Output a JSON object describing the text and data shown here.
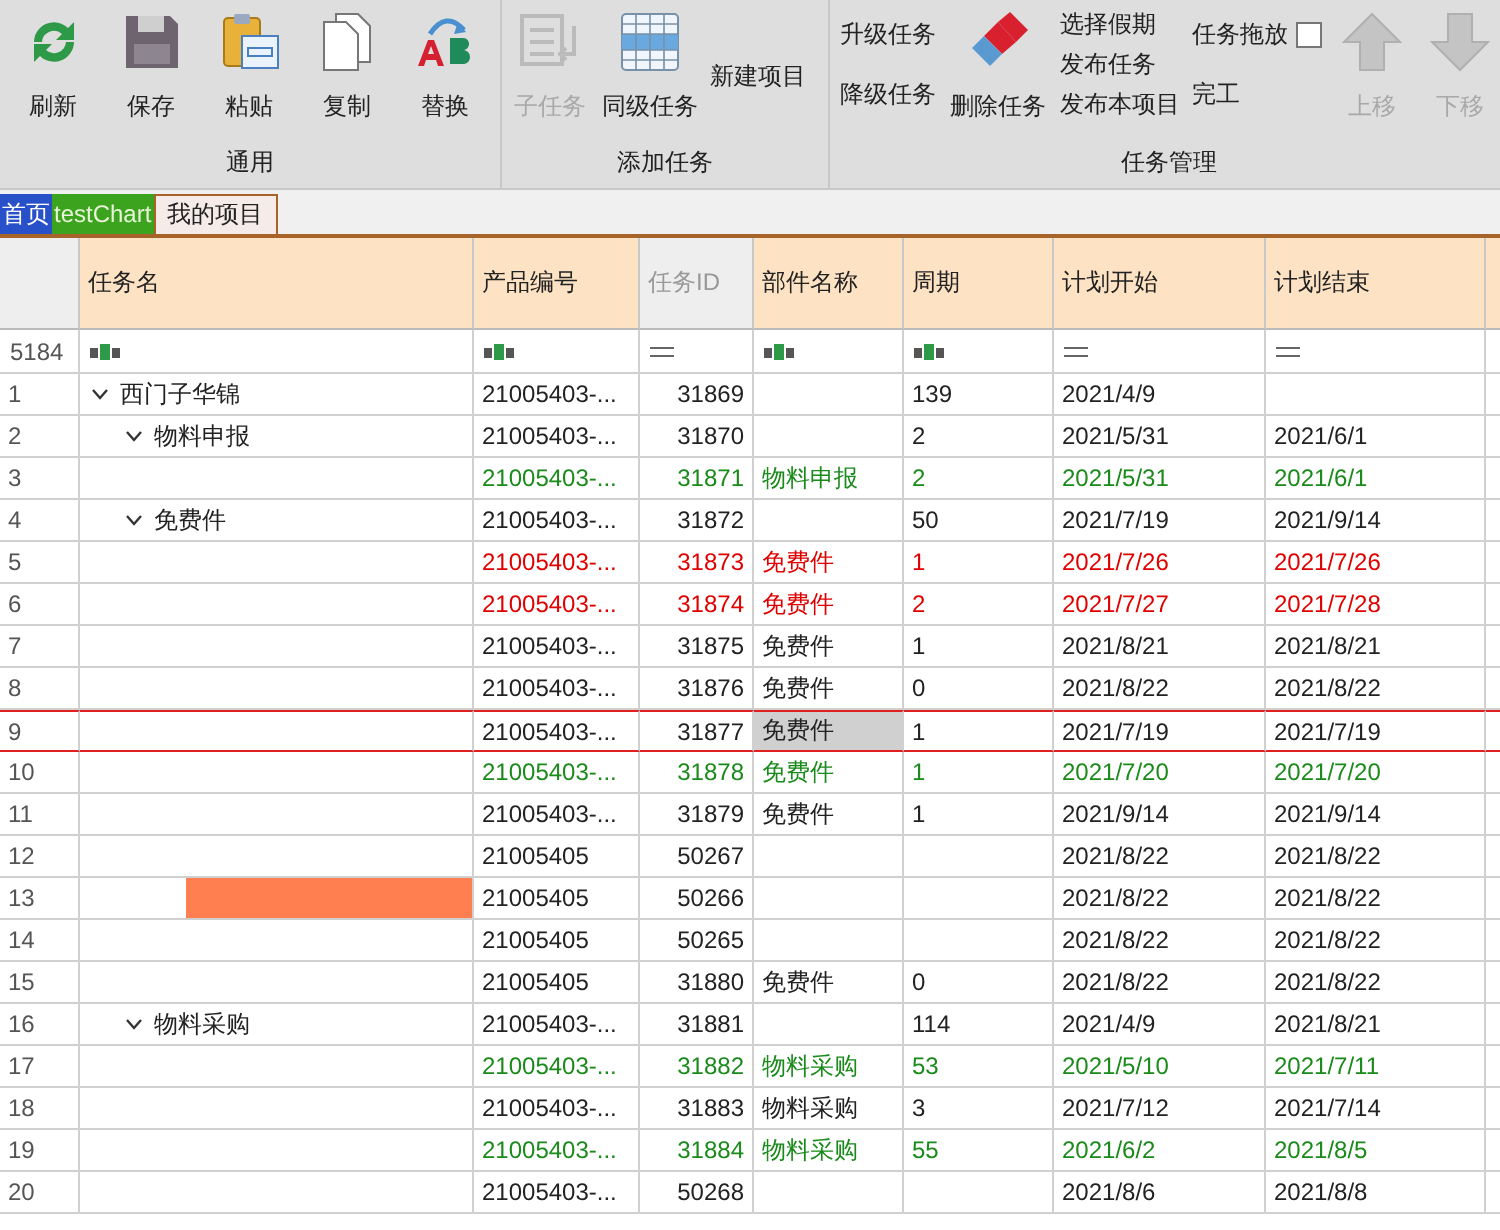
{
  "toolbar": {
    "groups": [
      {
        "label": "通用",
        "items": [
          {
            "kind": "large",
            "label": "刷新",
            "disabled": false
          },
          {
            "kind": "large",
            "label": "保存",
            "disabled": false
          },
          {
            "kind": "large",
            "label": "粘贴",
            "disabled": false
          },
          {
            "kind": "large",
            "label": "复制",
            "disabled": false
          },
          {
            "kind": "large",
            "label": "替换",
            "disabled": false
          }
        ]
      },
      {
        "label": "添加任务",
        "items": [
          {
            "kind": "large",
            "label": "子任务",
            "disabled": true
          },
          {
            "kind": "large",
            "label": "同级任务",
            "disabled": false
          },
          {
            "kind": "text",
            "label": "新建项目",
            "disabled": false
          }
        ]
      },
      {
        "label": "任务管理",
        "items": [
          {
            "kind": "stack",
            "entries": [
              {
                "label": "升级任务"
              },
              {
                "label": "降级任务"
              }
            ]
          },
          {
            "kind": "large",
            "label": "删除任务",
            "disabled": false
          },
          {
            "kind": "stack",
            "entries": [
              {
                "label": "选择假期"
              },
              {
                "label": "发布任务"
              },
              {
                "label": "发布本项目"
              }
            ]
          },
          {
            "kind": "checkstack",
            "check": {
              "label": "任务拖放",
              "checked": false
            },
            "label": "完工"
          },
          {
            "kind": "large",
            "label": "上移",
            "disabled": true
          },
          {
            "kind": "large",
            "label": "下移",
            "disabled": true
          }
        ]
      }
    ]
  },
  "tabs": [
    {
      "label": "首页",
      "color": "#2850c8",
      "selected": false
    },
    {
      "label": "testChart",
      "color": "#3ca31e",
      "selected": false
    },
    {
      "label": "我的项目",
      "color": "#f5ebe8",
      "selected": true
    }
  ],
  "grid": {
    "columns": [
      {
        "label": "任务名",
        "readonly": false,
        "kind": "text"
      },
      {
        "label": "产品编号",
        "readonly": false,
        "kind": "text"
      },
      {
        "label": "任务ID",
        "readonly": true,
        "kind": "equals"
      },
      {
        "label": "部件名称",
        "readonly": false,
        "kind": "text"
      },
      {
        "label": "周期",
        "readonly": false,
        "kind": "text"
      },
      {
        "label": "计划开始",
        "readonly": false,
        "kind": "equals"
      },
      {
        "label": "计划结束",
        "readonly": false,
        "kind": "equals"
      }
    ],
    "filter_count": "5184",
    "rows": [
      {
        "num": "1",
        "name": "西门子华锦",
        "expanded": true,
        "product": "21005403-...",
        "id": "31869",
        "period": "139",
        "start": "2021/4/9",
        "color": "#222222",
        "selected": false,
        "bar": false,
        "children": [
          {
            "num": "2",
            "name": "物料申报",
            "expanded": true,
            "product": "21005403-...",
            "id": "31870",
            "period": "2",
            "start": "2021/5/31",
            "end": "2021/6/1",
            "color": "#222222",
            "selected": false,
            "bar": false,
            "children": [
              {
                "num": "3",
                "product": "21005403-...",
                "id": "31871",
                "part": "物料申报",
                "period": "2",
                "start": "2021/5/31",
                "end": "2021/6/1",
                "color": "#1a8a1a",
                "selected": false,
                "bar": false
              }
            ]
          },
          {
            "num": "4",
            "name": "免费件",
            "expanded": true,
            "product": "21005403-...",
            "id": "31872",
            "period": "50",
            "start": "2021/7/19",
            "end": "2021/9/14",
            "color": "#222222",
            "selected": false,
            "bar": false,
            "children": [
              {
                "num": "5",
                "product": "21005403-...",
                "id": "31873",
                "part": "免费件",
                "period": "1",
                "start": "2021/7/26",
                "end": "2021/7/26",
                "color": "#e00000",
                "selected": false,
                "bar": false
              },
              {
                "num": "6",
                "product": "21005403-...",
                "id": "31874",
                "part": "免费件",
                "period": "2",
                "start": "2021/7/27",
                "end": "2021/7/28",
                "color": "#e00000",
                "selected": false,
                "bar": false
              },
              {
                "num": "7",
                "product": "21005403-...",
                "id": "31875",
                "part": "免费件",
                "period": "1",
                "start": "2021/8/21",
                "end": "2021/8/21",
                "color": "#222222",
                "selected": false,
                "bar": false
              },
              {
                "num": "8",
                "product": "21005403-...",
                "id": "31876",
                "part": "免费件",
                "period": "0",
                "start": "2021/8/22",
                "end": "2021/8/22",
                "color": "#222222",
                "selected": false,
                "bar": false
              },
              {
                "num": "9",
                "product": "21005403-...",
                "id": "31877",
                "part": "免费件",
                "period": "1",
                "start": "2021/7/19",
                "end": "2021/7/19",
                "color": "#222222",
                "selected": true,
                "bar": false
              },
              {
                "num": "10",
                "product": "21005403-...",
                "id": "31878",
                "part": "免费件",
                "period": "1",
                "start": "2021/7/20",
                "end": "2021/7/20",
                "color": "#1a8a1a",
                "selected": false,
                "bar": false
              },
              {
                "num": "11",
                "product": "21005403-...",
                "id": "31879",
                "part": "免费件",
                "period": "1",
                "start": "2021/9/14",
                "end": "2021/9/14",
                "color": "#222222",
                "selected": false,
                "bar": false
              },
              {
                "num": "12",
                "product": "21005405",
                "id": "50267",
                "start": "2021/8/22",
                "end": "2021/8/22",
                "color": "#222222",
                "selected": false,
                "bar": false
              },
              {
                "num": "13",
                "product": "21005405",
                "id": "50266",
                "start": "2021/8/22",
                "end": "2021/8/22",
                "color": "#222222",
                "selected": false,
                "bar": true
              },
              {
                "num": "14",
                "product": "21005405",
                "id": "50265",
                "start": "2021/8/22",
                "end": "2021/8/22",
                "color": "#222222",
                "selected": false,
                "bar": false
              },
              {
                "num": "15",
                "product": "21005405",
                "id": "31880",
                "part": "免费件",
                "period": "0",
                "start": "2021/8/22",
                "end": "2021/8/22",
                "color": "#222222",
                "selected": false,
                "bar": false
              }
            ]
          },
          {
            "num": "16",
            "name": "物料采购",
            "expanded": true,
            "product": "21005403-...",
            "id": "31881",
            "period": "114",
            "start": "2021/4/9",
            "end": "2021/8/21",
            "color": "#222222",
            "selected": false,
            "bar": false,
            "children": [
              {
                "num": "17",
                "product": "21005403-...",
                "id": "31882",
                "part": "物料采购",
                "period": "53",
                "start": "2021/5/10",
                "end": "2021/7/11",
                "color": "#1a8a1a",
                "selected": false,
                "bar": false
              },
              {
                "num": "18",
                "product": "21005403-...",
                "id": "31883",
                "part": "物料采购",
                "period": "3",
                "start": "2021/7/12",
                "end": "2021/7/14",
                "color": "#222222",
                "selected": false,
                "bar": false
              },
              {
                "num": "19",
                "product": "21005403-...",
                "id": "31884",
                "part": "物料采购",
                "period": "55",
                "start": "2021/6/2",
                "end": "2021/8/5",
                "color": "#1a8a1a",
                "selected": false,
                "bar": false
              },
              {
                "num": "20",
                "product": "21005403-...",
                "id": "50268",
                "start": "2021/8/6",
                "end": "2021/8/8",
                "color": "#222222",
                "selected": false,
                "bar": false
              }
            ]
          }
        ]
      }
    ]
  }
}
